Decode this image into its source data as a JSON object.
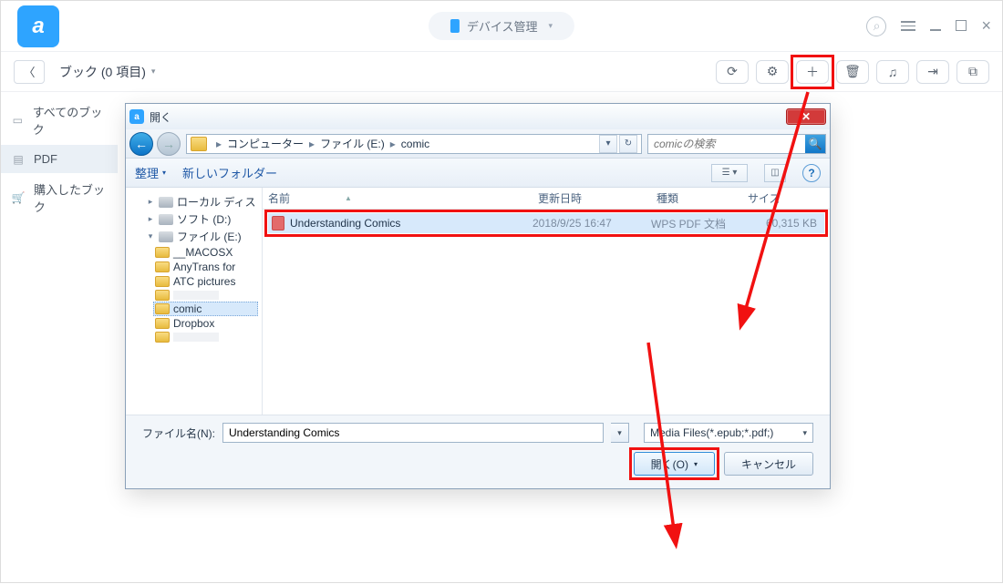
{
  "titlebar": {
    "device_label": "デバイス管理"
  },
  "toolbar": {
    "breadcrumb": "ブック (0 項目)"
  },
  "sidebar": {
    "items": [
      {
        "label": "すべてのブック"
      },
      {
        "label": "PDF"
      },
      {
        "label": "購入したブック"
      }
    ]
  },
  "dialog": {
    "title": "開く",
    "path": {
      "seg1": "コンピューター",
      "seg2": "ファイル (E:)",
      "seg3": "comic"
    },
    "search_placeholder": "comicの検索",
    "toolbar": {
      "organize": "整理",
      "new_folder": "新しいフォルダー"
    },
    "tree": {
      "local_disk": "ローカル ディス",
      "soft": "ソフト (D:)",
      "file": "ファイル (E:)",
      "folders": [
        "__MACOSX",
        "AnyTrans for",
        "ATC pictures",
        "comic",
        "Dropbox"
      ]
    },
    "columns": {
      "name": "名前",
      "modified": "更新日時",
      "type": "種類",
      "size": "サイズ"
    },
    "file": {
      "name": "Understanding Comics",
      "date": "2018/9/25 16:47",
      "type": "WPS PDF 文档",
      "size": "60,315 KB"
    },
    "footer": {
      "fn_label": "ファイル名(N):",
      "fn_value": "Understanding Comics",
      "filter": "Media Files(*.epub;*.pdf;)",
      "open": "開く(O)",
      "cancel": "キャンセル"
    }
  }
}
